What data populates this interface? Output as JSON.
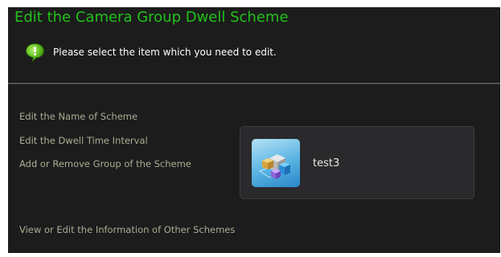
{
  "header": {
    "title": "Edit the Camera Group Dwell Scheme",
    "title_color": "#21c21a",
    "hint_icon": "speech-bubble-exclamation-icon",
    "hint_text": "Please select the item which you need to edit."
  },
  "menu": {
    "items": [
      {
        "label": "Edit the Name of Scheme"
      },
      {
        "label": "Edit the Dwell Time Interval"
      },
      {
        "label": "Add or Remove Group of the Scheme"
      },
      {
        "label": "View or Edit the Information of Other Schemes"
      }
    ],
    "link_color": "#a9ae93"
  },
  "scheme": {
    "icon": "camera-group-cubes-icon",
    "name": "test3"
  },
  "colors": {
    "background": "#1c1c1c",
    "box_background": "#2a2a2c"
  }
}
